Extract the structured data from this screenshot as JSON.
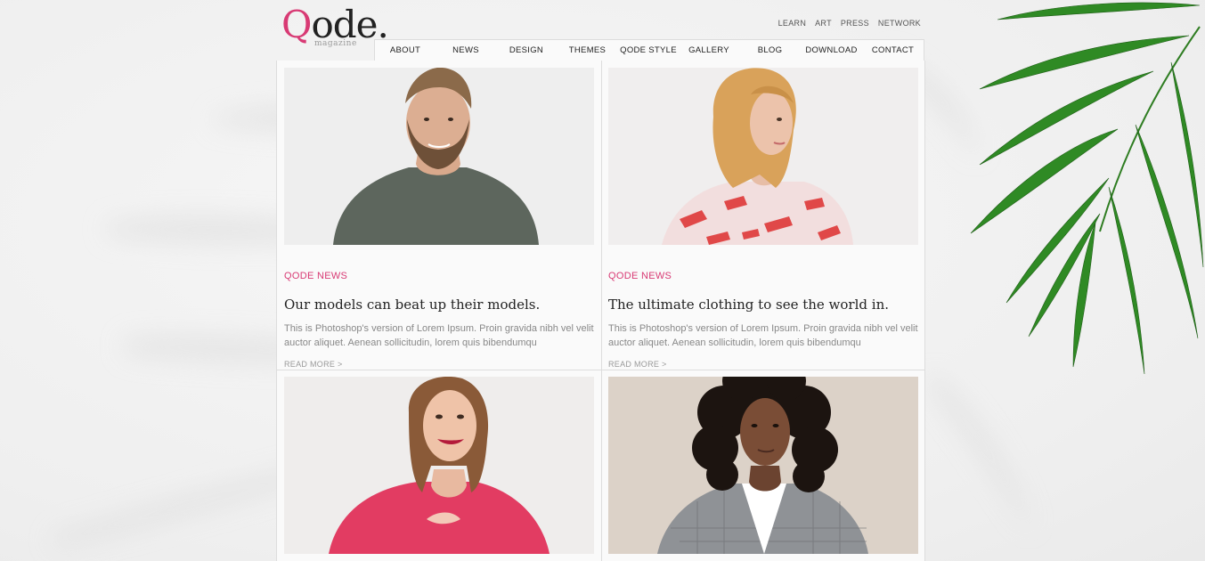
{
  "logo": {
    "mark_q": "Q",
    "mark_rest": "ode.",
    "sub": "magazine"
  },
  "top_links": [
    "LEARN",
    "ART",
    "PRESS",
    "NETWORK"
  ],
  "nav": [
    "ABOUT",
    "NEWS",
    "DESIGN",
    "THEMES",
    "QODE STYLE",
    "GALLERY",
    "BLOG",
    "DOWNLOAD",
    "CONTACT"
  ],
  "posts": [
    {
      "category": "QODE NEWS",
      "title": "Our models can beat up their models.",
      "excerpt": "This is Photoshop's version of Lorem Ipsum. Proin gravida nibh vel velit auctor aliquet. Aenean sollicitudin, lorem quis bibendumqu",
      "read_more": "READ MORE >"
    },
    {
      "category": "QODE NEWS",
      "title": "The ultimate clothing to see the world in.",
      "excerpt": "This is Photoshop's version of Lorem Ipsum. Proin gravida nibh vel velit auctor aliquet. Aenean sollicitudin, lorem quis bibendumqu",
      "read_more": "READ MORE >"
    }
  ],
  "colors": {
    "accent": "#d83a74",
    "text": "#222222",
    "muted": "#888888",
    "border": "#dddddd"
  }
}
